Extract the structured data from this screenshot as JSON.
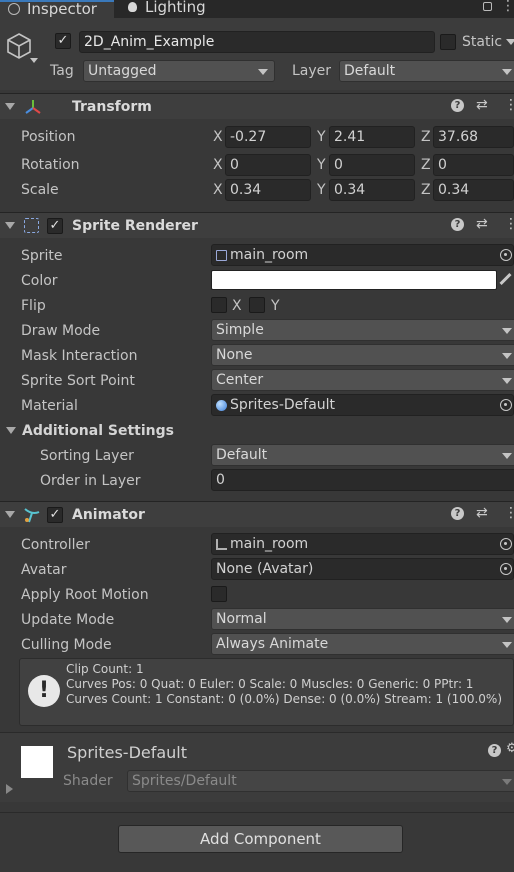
{
  "tabs": {
    "inspector": "Inspector",
    "lighting": "Lighting"
  },
  "object": {
    "name": "2D_Anim_Example",
    "static_label": "Static",
    "tag_label": "Tag",
    "tag_value": "Untagged",
    "layer_label": "Layer",
    "layer_value": "Default"
  },
  "transform": {
    "title": "Transform",
    "position_label": "Position",
    "rotation_label": "Rotation",
    "scale_label": "Scale",
    "axis_x": "X",
    "axis_y": "Y",
    "axis_z": "Z",
    "position": {
      "x": "-0.27",
      "y": "2.41",
      "z": "37.68"
    },
    "rotation": {
      "x": "0",
      "y": "0",
      "z": "0"
    },
    "scale": {
      "x": "0.34",
      "y": "0.34",
      "z": "0.34"
    }
  },
  "sprite_renderer": {
    "title": "Sprite Renderer",
    "sprite_label": "Sprite",
    "sprite_value": "main_room",
    "color_label": "Color",
    "color_value": "#ffffff",
    "flip_label": "Flip",
    "flip_x": "X",
    "flip_y": "Y",
    "draw_mode_label": "Draw Mode",
    "draw_mode_value": "Simple",
    "mask_label": "Mask Interaction",
    "mask_value": "None",
    "sort_point_label": "Sprite Sort Point",
    "sort_point_value": "Center",
    "material_label": "Material",
    "material_value": "Sprites-Default",
    "additional_label": "Additional Settings",
    "sorting_layer_label": "Sorting Layer",
    "sorting_layer_value": "Default",
    "order_label": "Order in Layer",
    "order_value": "0"
  },
  "animator": {
    "title": "Animator",
    "controller_label": "Controller",
    "controller_value": "main_room",
    "avatar_label": "Avatar",
    "avatar_value": "None (Avatar)",
    "root_motion_label": "Apply Root Motion",
    "update_label": "Update Mode",
    "update_value": "Normal",
    "culling_label": "Culling Mode",
    "culling_value": "Always Animate",
    "info_line1": "Clip Count: 1",
    "info_line2": "Curves Pos: 0 Quat: 0 Euler: 0 Scale: 0 Muscles: 0 Generic: 0 PPtr: 1",
    "info_line3": "Curves Count: 1 Constant: 0 (0.0%) Dense: 0 (0.0%) Stream: 1 (100.0%)"
  },
  "material_preview": {
    "name": "Sprites-Default",
    "shader_label": "Shader",
    "shader_value": "Sprites/Default"
  },
  "add_component_label": "Add Component",
  "colors": {
    "accent": "#3a79bb",
    "panel": "#383838",
    "header": "#3e3e3e",
    "field": "#2a2a2a"
  }
}
